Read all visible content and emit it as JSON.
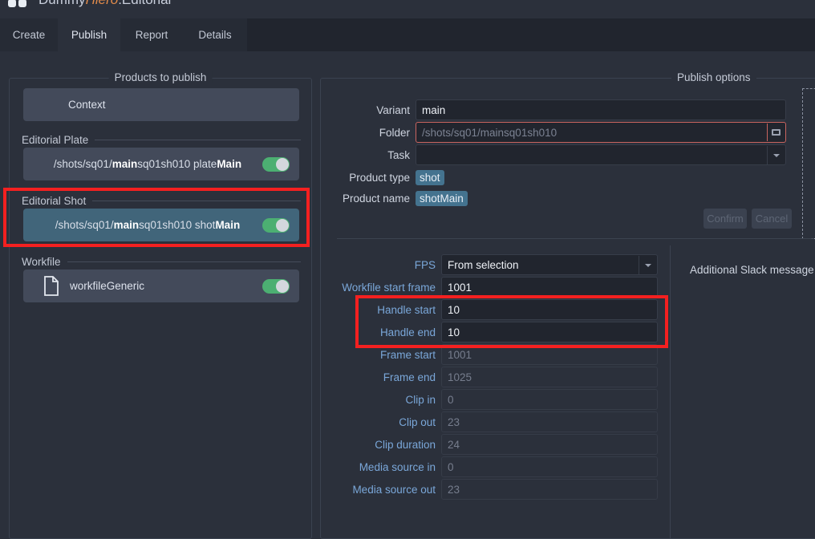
{
  "window": {
    "title_prefix": "Dummy",
    "title_accent": "Hiero",
    "title_suffix": ":Editorial",
    "icon": "app-logo-icon"
  },
  "tabs": [
    {
      "label": "Create",
      "active": false
    },
    {
      "label": "Publish",
      "active": true
    },
    {
      "label": "Report",
      "active": false
    },
    {
      "label": "Details",
      "active": false
    }
  ],
  "left_panel": {
    "title": "Products to publish",
    "context_row": {
      "label": "Context",
      "enabled_toggle": false
    },
    "sections": [
      {
        "heading": "Editorial Plate",
        "row": {
          "path_prefix": "/shots/sq01/",
          "path_bold1": "main",
          "path_mid": "sq01sh010 plate",
          "path_bold2": "Main",
          "full_path": "/shots/sq01/mainsq01sh010 plateMain",
          "toggle_on": true,
          "selected": false
        }
      },
      {
        "heading": "Editorial Shot",
        "row": {
          "path_prefix": "/shots/sq01/",
          "path_bold1": "main",
          "path_mid": "sq01sh010 shot",
          "path_bold2": "Main",
          "full_path": "/shots/sq01/mainsq01sh010 shotMain",
          "toggle_on": true,
          "selected": true
        }
      },
      {
        "heading": "Workfile",
        "row": {
          "name": "workfileGeneric",
          "icon": "document-icon",
          "toggle_on": true,
          "selected": false
        }
      }
    ]
  },
  "right_panel": {
    "title": "Publish options",
    "fields": [
      {
        "label": "Variant",
        "value": "main",
        "state": "filled",
        "widget": "text"
      },
      {
        "label": "Folder",
        "value": "/shots/sq01/mainsq01sh010",
        "state": "placeholder",
        "widget": "text-browse"
      },
      {
        "label": "Task",
        "value": "",
        "state": "empty",
        "widget": "combobox"
      }
    ],
    "product_type": {
      "label": "Product type",
      "chip": "shot"
    },
    "product_name": {
      "label": "Product name",
      "chip": "shotMain"
    },
    "buttons": [
      {
        "label": "Confirm",
        "disabled": true
      },
      {
        "label": "Cancel",
        "disabled": true
      }
    ],
    "slack_label": "Additional Slack message",
    "attributes": [
      {
        "label": "FPS",
        "value": "From selection",
        "state": "filled",
        "widget": "combobox",
        "highlight": false
      },
      {
        "label": "Workfile start frame",
        "value": "1001",
        "state": "filled",
        "widget": "text",
        "highlight": false
      },
      {
        "label": "Handle start",
        "value": "10",
        "state": "filled",
        "widget": "text",
        "highlight": true
      },
      {
        "label": "Handle end",
        "value": "10",
        "state": "filled",
        "widget": "text",
        "highlight": true
      },
      {
        "label": "Frame start",
        "value": "1001",
        "state": "ghost",
        "widget": "text",
        "highlight": false
      },
      {
        "label": "Frame end",
        "value": "1025",
        "state": "ghost",
        "widget": "text",
        "highlight": false
      },
      {
        "label": "Clip in",
        "value": "0",
        "state": "ghost",
        "widget": "text",
        "highlight": false
      },
      {
        "label": "Clip out",
        "value": "23",
        "state": "ghost",
        "widget": "text",
        "highlight": false
      },
      {
        "label": "Clip duration",
        "value": "24",
        "state": "ghost",
        "widget": "text",
        "highlight": false
      },
      {
        "label": "Media source in",
        "value": "0",
        "state": "ghost",
        "widget": "text",
        "highlight": false
      },
      {
        "label": "Media source out",
        "value": "23",
        "state": "ghost",
        "widget": "text",
        "highlight": false
      }
    ]
  },
  "annotations": [
    {
      "name": "editorial-shot-highlight",
      "color": "#f42020"
    },
    {
      "name": "handles-highlight",
      "color": "#f42020"
    }
  ],
  "colors": {
    "background": "#2b303b",
    "tabbar": "#21252e",
    "row": "#434a5a",
    "row_selected": "#41657a",
    "toggle_on": "#4caf72",
    "chip": "#44738f",
    "label_blue": "#7aa7d9",
    "annotation_red": "#f42020",
    "field_error_border": "#c9645f"
  }
}
